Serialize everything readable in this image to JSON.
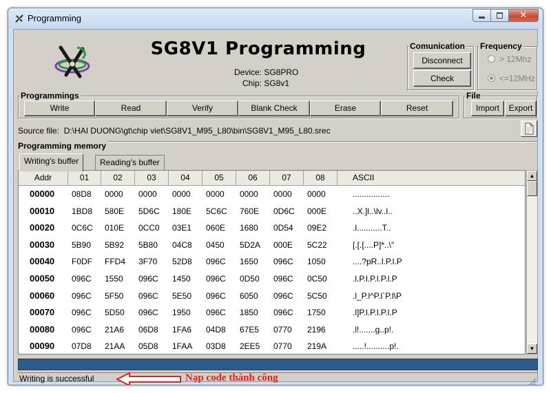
{
  "window": {
    "title": "Programming"
  },
  "header": {
    "heading": "SG8V1 Programming",
    "device": "Device: SG8PRO",
    "chip": "Chip: SG8v1"
  },
  "communication": {
    "label": "Comunication",
    "disconnect": "Disconnect",
    "check": "Check"
  },
  "frequency": {
    "label": "Frequency",
    "options": [
      {
        "label": "> 12Mhz",
        "selected": false
      },
      {
        "label": "<=12MHz",
        "selected": true
      }
    ]
  },
  "programmings": {
    "label": "Programmings",
    "buttons": [
      "Write",
      "Read",
      "Verify",
      "Blank Check",
      "Erase",
      "Reset"
    ]
  },
  "file": {
    "label": "File",
    "import": "Import",
    "export": "Export"
  },
  "source": {
    "label": "Source file:",
    "path": "D:\\HAI DUONG\\gt\\chip viet\\SG8V1_M95_L80\\bin\\SG8V1_M95_L80.srec"
  },
  "memory": {
    "label": "Programming memory",
    "tabs": [
      "Writing's buffer",
      "Reading's buffer"
    ],
    "active_tab": 0,
    "columns": [
      "Addr",
      "01",
      "02",
      "03",
      "04",
      "05",
      "06",
      "07",
      "08",
      "ASCII"
    ],
    "rows": [
      [
        "00000",
        "08D8",
        "0000",
        "0000",
        "0000",
        "0000",
        "0000",
        "0000",
        "0000",
        "................"
      ],
      [
        "00010",
        "1BD8",
        "580E",
        "5D6C",
        "180E",
        "5C6C",
        "760E",
        "0D6C",
        "000E",
        "..X.]l..\\lv..l.."
      ],
      [
        "00020",
        "0C6C",
        "010E",
        "0CC0",
        "03E1",
        "060E",
        "1680",
        "0D54",
        "09E2",
        ".l...........T.."
      ],
      [
        "00030",
        "5B90",
        "5B92",
        "5B80",
        "04C8",
        "0450",
        "5D2A",
        "000E",
        "5C22",
        "[.[.[....P]*..\\\""
      ],
      [
        "00040",
        "F0DF",
        "FFD4",
        "3F70",
        "52D8",
        "096C",
        "1650",
        "096C",
        "1050",
        "....?pR..l.P.l.P"
      ],
      [
        "00050",
        "096C",
        "1550",
        "096C",
        "1450",
        "096C",
        "0D50",
        "096C",
        "0C50",
        ".l.P.l.P.l.P.l.P"
      ],
      [
        "00060",
        "096C",
        "5F50",
        "096C",
        "5E50",
        "096C",
        "6050",
        "096C",
        "5C50",
        ".l_P.l^P.l`P.l\\P"
      ],
      [
        "00070",
        "096C",
        "5D50",
        "096C",
        "1950",
        "096C",
        "1850",
        "096C",
        "1750",
        ".l]P.l.P.l.P.l.P"
      ],
      [
        "00080",
        "096C",
        "21A6",
        "06D8",
        "1FA6",
        "04D8",
        "67E5",
        "0770",
        "2196",
        ".l!.......g..p!."
      ],
      [
        "00090",
        "07D8",
        "21AA",
        "05D8",
        "1FAA",
        "03D8",
        "2EE5",
        "0770",
        "219A",
        ".....!..........p!."
      ]
    ]
  },
  "status": {
    "message": "Writing is successful",
    "annotation": "Nạp code thành công"
  },
  "colors": {
    "progress": "#2f5b8a",
    "annotation": "#e0241b"
  }
}
